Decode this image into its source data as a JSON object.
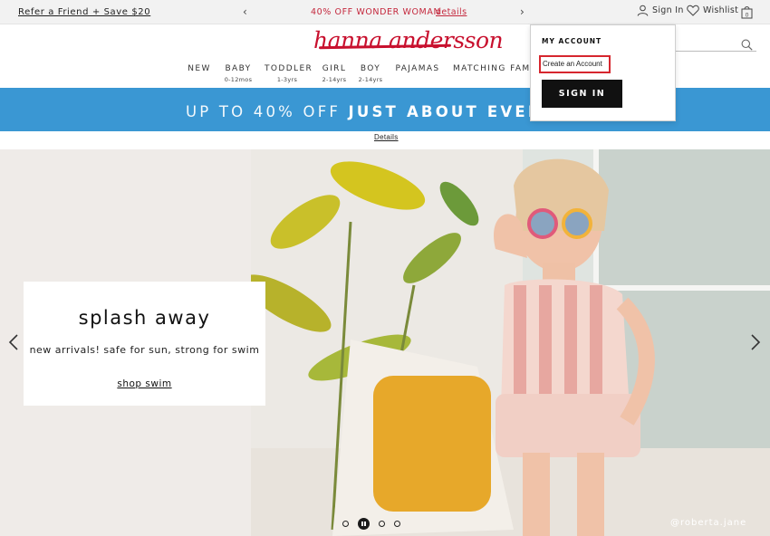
{
  "topbar": {
    "referral": "Refer a Friend + Save $20",
    "promo_text": "40% OFF WONDER WOMAN",
    "promo_link": "details",
    "prev_icon": "chevron-left-icon",
    "next_icon": "chevron-right-icon",
    "signin_label": "Sign In",
    "wishlist_label": "Wishlist",
    "bag_count": "0"
  },
  "header": {
    "logo": "hanna andersson",
    "brand_color": "#c8102e"
  },
  "nav": {
    "items": [
      {
        "label": "NEW",
        "sub": ""
      },
      {
        "label": "BABY",
        "sub": "0-12mos"
      },
      {
        "label": "TODDLER",
        "sub": "1-3yrs"
      },
      {
        "label": "GIRL",
        "sub": "2-14yrs"
      },
      {
        "label": "BOY",
        "sub": "2-14yrs"
      },
      {
        "label": "PAJAMAS",
        "sub": ""
      },
      {
        "label": "MATCHING FAM",
        "sub": ""
      }
    ]
  },
  "banner": {
    "text_light": "UP TO 40% OFF",
    "text_bold": "JUST ABOUT EVERYT",
    "details": "Details",
    "color": "#3a97d3"
  },
  "hero": {
    "title": "splash away",
    "subtitle": "new arrivals! safe for sun, strong for swim",
    "link": "shop swim",
    "credit": "@roberta.jane",
    "slide_count": 4,
    "active_slide": 2
  },
  "account_menu": {
    "title": "MY ACCOUNT",
    "create_link": "Create an Account",
    "signin_button": "SIGN IN",
    "highlight_color": "#d6262e"
  }
}
